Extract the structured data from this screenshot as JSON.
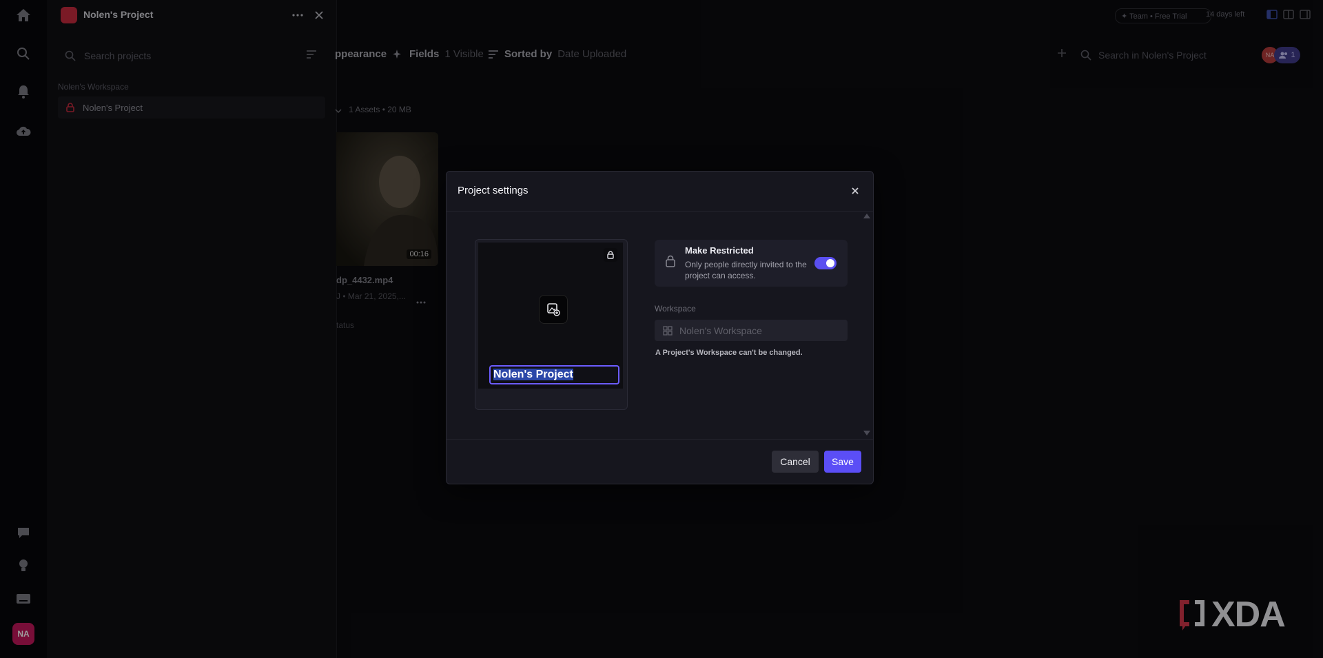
{
  "panel": {
    "project_title": "Nolen's Project",
    "search_placeholder": "Search projects",
    "workspace_label": "Nolen's Workspace",
    "project_item": "Nolen's Project"
  },
  "topbar": {
    "plan_badge": "✦ Team • Free Trial",
    "trial_left": "14 days left"
  },
  "toolbar": {
    "appearance": "ppearance",
    "fields_label": "Fields",
    "fields_value": "1 Visible",
    "sorted_label": "Sorted by",
    "sorted_value": "Date Uploaded",
    "search_placeholder": "Search in Nolen's Project",
    "avatar_initials": "NA",
    "member_count": "1"
  },
  "assets": {
    "summary": "1 Assets • 20 MB",
    "items": [
      {
        "name": "dp_4432.mp4",
        "meta": "J • Mar 21, 2025,...",
        "duration": "00:16",
        "status": "tatus"
      }
    ]
  },
  "modal": {
    "title": "Project settings",
    "project_name": "Nolen's Project",
    "restricted_heading": "Make Restricted",
    "restricted_desc": "Only people directly invited to the project can access.",
    "restricted_on": true,
    "workspace_label": "Workspace",
    "workspace_value": "Nolen's Workspace",
    "workspace_note": "A Project's Workspace can't be changed.",
    "cancel_label": "Cancel",
    "save_label": "Save"
  },
  "rail": {
    "user_initials": "NA",
    "icons": [
      "home-icon",
      "search-icon",
      "bell-icon",
      "cloud-upload-icon",
      "chat-icon",
      "lightbulb-icon",
      "keyboard-icon"
    ]
  },
  "watermark": {
    "text": "XDA"
  },
  "colors": {
    "accent": "#5b4ef6",
    "project_logo": "#c62a3e",
    "background": "#0b0b0e"
  }
}
